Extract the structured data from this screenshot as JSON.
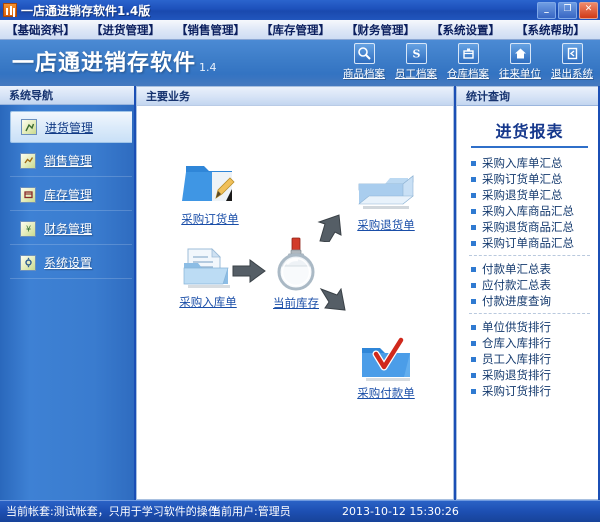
{
  "window": {
    "title": "一店通进销存软件1.4版",
    "app_icon": "chart-icon",
    "minimize_label": "_",
    "maximize_label": "❐",
    "close_label": "✕"
  },
  "menubar": {
    "items": [
      {
        "label": "【基础资料】",
        "name": "menu-basic-data"
      },
      {
        "label": "【进货管理】",
        "name": "menu-purchase"
      },
      {
        "label": "【销售管理】",
        "name": "menu-sales"
      },
      {
        "label": "【库存管理】",
        "name": "menu-inventory"
      },
      {
        "label": "【财务管理】",
        "name": "menu-finance"
      },
      {
        "label": "【系统设置】",
        "name": "menu-settings"
      },
      {
        "label": "【系统帮助】",
        "name": "menu-help"
      }
    ]
  },
  "banner": {
    "logo_text": "一店通进销存软件",
    "version": "1.4",
    "toolbar": [
      {
        "label": "商品档案",
        "icon": "magnifier-icon"
      },
      {
        "label": "员工档案",
        "icon": "person-s-icon"
      },
      {
        "label": "仓库档案",
        "icon": "warehouse-icon"
      },
      {
        "label": "往来单位",
        "icon": "home-icon"
      },
      {
        "label": "退出系统",
        "icon": "exit-door-icon"
      }
    ]
  },
  "sidebar": {
    "caption": "系统导航",
    "items": [
      {
        "label": "进货管理",
        "icon": "purchase-icon",
        "active": true
      },
      {
        "label": "销售管理",
        "icon": "sales-icon",
        "active": false
      },
      {
        "label": "库存管理",
        "icon": "stock-icon",
        "active": false
      },
      {
        "label": "财务管理",
        "icon": "finance-icon",
        "active": false
      },
      {
        "label": "系统设置",
        "icon": "settings-icon",
        "active": false
      }
    ]
  },
  "main": {
    "caption": "主要业务",
    "nodes": [
      {
        "label": "采购订货单",
        "icon": "folder-pencil-icon"
      },
      {
        "label": "采购退货单",
        "icon": "folder-open-icon"
      },
      {
        "label": "采购入库单",
        "icon": "folder-document-icon"
      },
      {
        "label": "当前库存",
        "icon": "magnifier-stock-icon"
      },
      {
        "label": "采购付款单",
        "icon": "folder-check-icon"
      }
    ]
  },
  "rightpanel": {
    "caption": "统计查询",
    "title": "进货报表",
    "groups": [
      {
        "items": [
          "采购入库单汇总",
          "采购订货单汇总",
          "采购退货单汇总",
          "采购入库商品汇总",
          "采购退货商品汇总",
          "采购订单商品汇总"
        ]
      },
      {
        "items": [
          "付款单汇总表",
          "应付款汇总表",
          "付款进度查询"
        ]
      },
      {
        "items": [
          "单位供货排行",
          "仓库入库排行",
          "员工入库排行",
          "采购退货排行",
          "采购订货排行"
        ]
      }
    ]
  },
  "statusbar": {
    "account": "当前帐套:测试帐套，只用于学习软件的操作",
    "user": "当前用户:管理员",
    "datetime": "2013-10-12 15:30:26"
  },
  "colors": {
    "window_frame": "#1b4fb5",
    "banner_blue": "#3a7cc8",
    "accent_link": "#1a4ea8",
    "bullet": "#2f7ad1",
    "title_text": "#16388c"
  }
}
